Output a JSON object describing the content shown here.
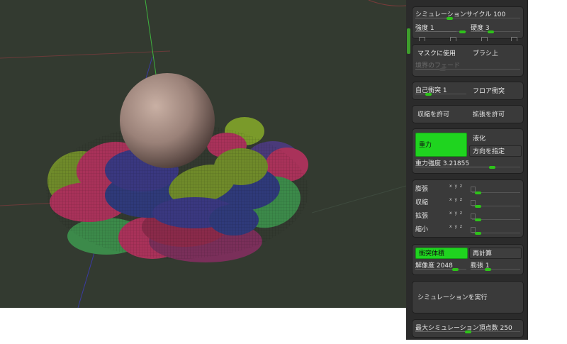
{
  "colors": {
    "accent": "#1fd41f",
    "panel_bg": "#2b2b2b",
    "group_bg": "#3a3a3a",
    "viewport_bg": "#333a30"
  },
  "simulation": {
    "cycles_label": "シミュレーションサイクル",
    "cycles_value": "100",
    "strength_label": "強度",
    "strength_value": "1",
    "hardness_label": "硬度",
    "hardness_value": "3"
  },
  "mask": {
    "use_mask": "マスクに使用",
    "brush_on": "ブラシ上",
    "border_fade": "境界のフェード"
  },
  "collision": {
    "self_label": "自己衝突",
    "self_value": "1",
    "floor": "フロア衝突"
  },
  "transform": {
    "allow_shrink": "収縮を許可",
    "allow_expand": "拡張を許可"
  },
  "gravity": {
    "gravity": "重力",
    "liquefy": "液化",
    "direction": "方向を指定",
    "strength_label": "重力強度",
    "strength_value": "3.21855"
  },
  "deform": {
    "xyz_label": "x y z",
    "rows": [
      {
        "label": "膨張"
      },
      {
        "label": "収縮"
      },
      {
        "label": "拡張"
      },
      {
        "label": "縮小"
      }
    ]
  },
  "volume": {
    "collision_volume": "衝突体積",
    "recalc": "再計算",
    "resolution_label": "解像度",
    "resolution_value": "2048",
    "inflate_label": "膨張",
    "inflate_value": "1"
  },
  "run": {
    "label": "シミュレーションを実行"
  },
  "max_vertices": {
    "label": "最大シミュレーション頂点数",
    "value": "250"
  }
}
